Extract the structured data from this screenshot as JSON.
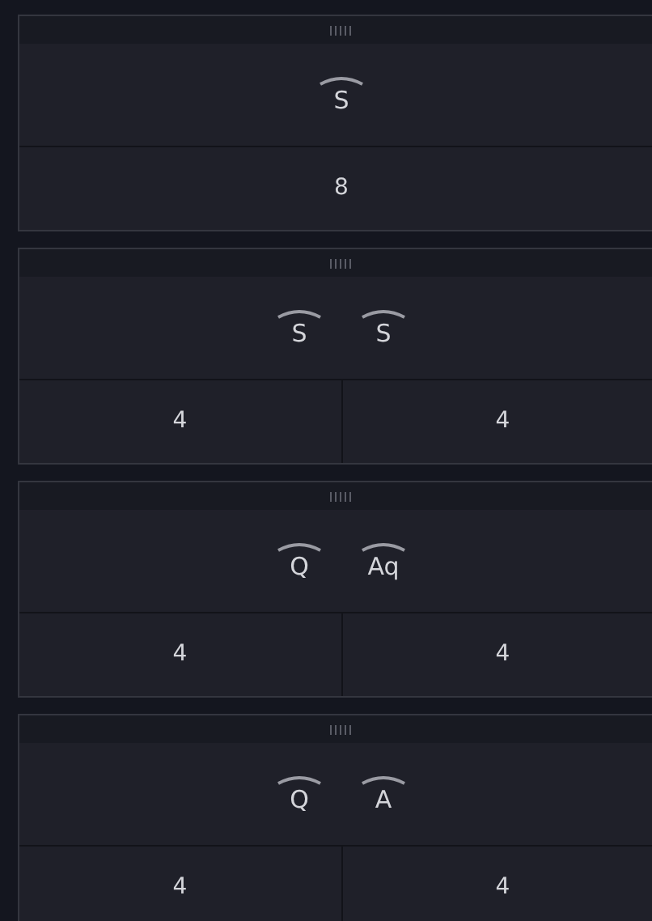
{
  "panels": [
    {
      "keys": [
        "S"
      ],
      "cells": [
        "8"
      ]
    },
    {
      "keys": [
        "S",
        "S"
      ],
      "cells": [
        "4",
        "4"
      ]
    },
    {
      "keys": [
        "Q",
        "Aq"
      ],
      "cells": [
        "4",
        "4"
      ]
    },
    {
      "keys": [
        "Q",
        "A"
      ],
      "cells": [
        "4",
        "4"
      ]
    }
  ]
}
